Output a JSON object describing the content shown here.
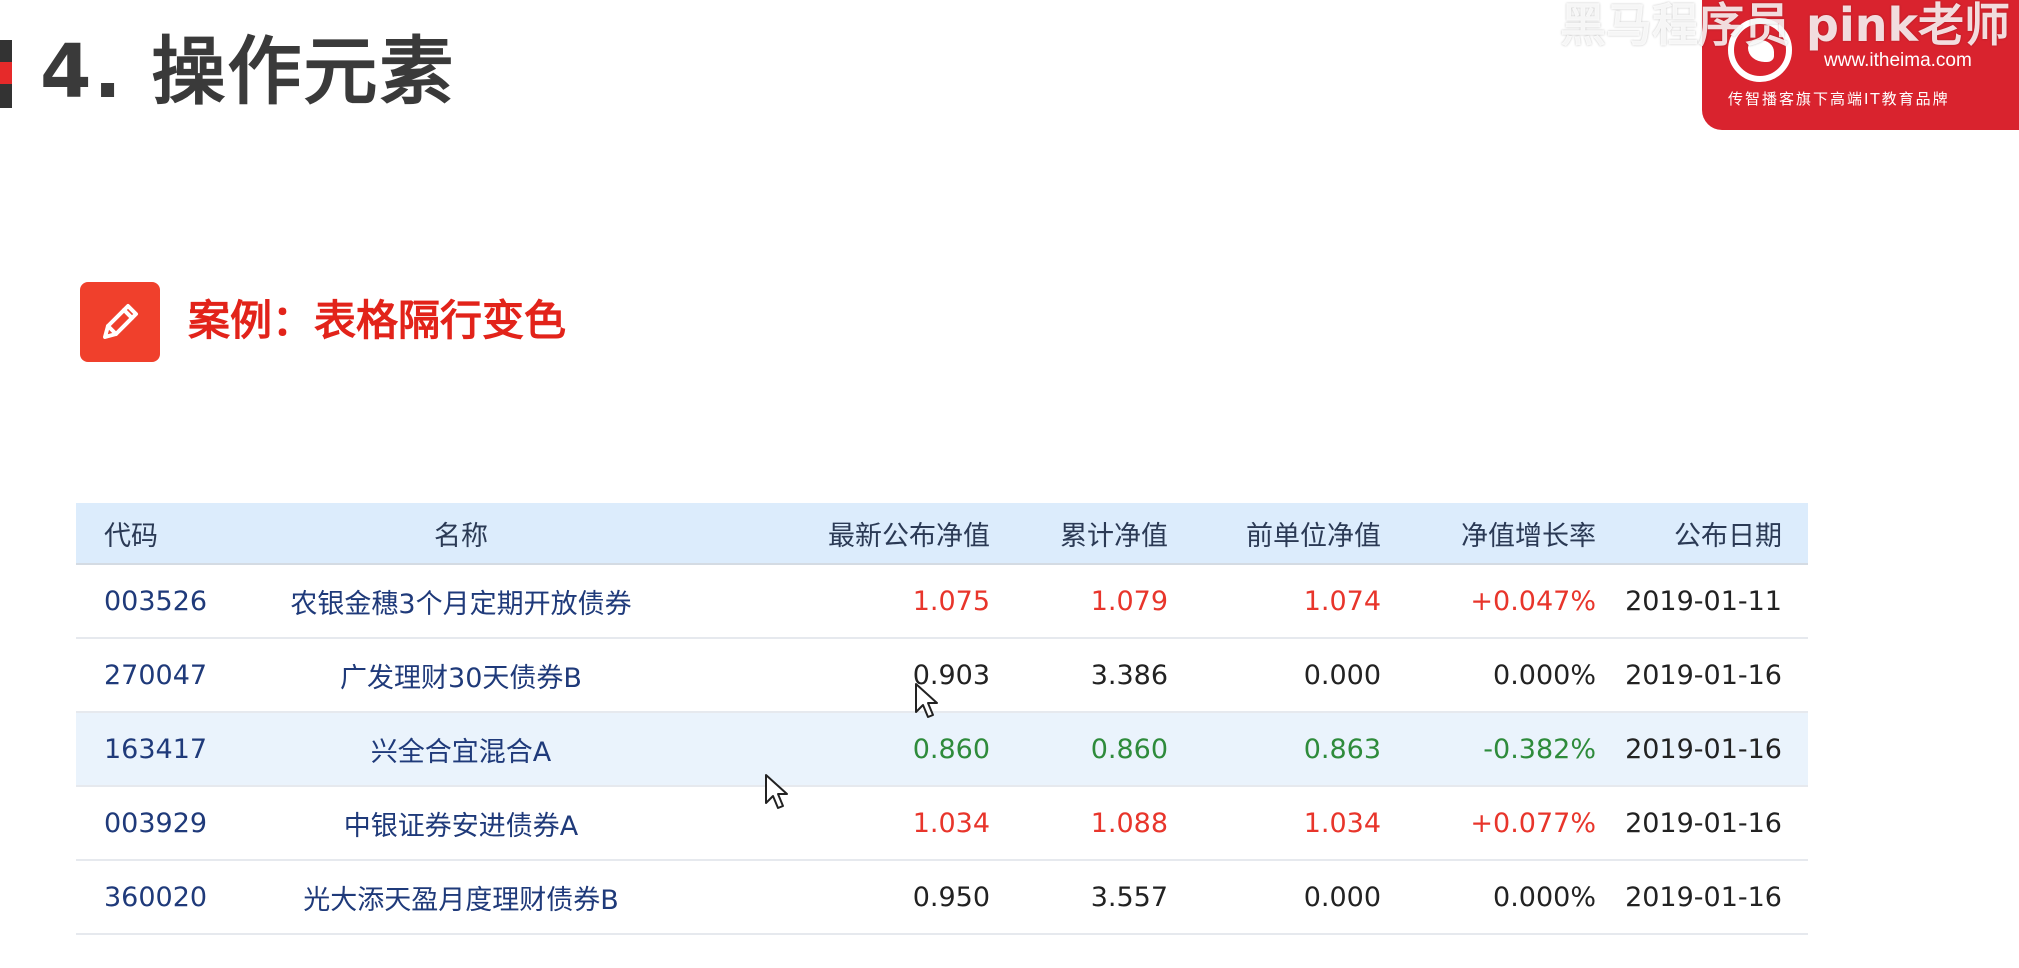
{
  "header": {
    "title": "4. 操作元素",
    "watermark": "黑马程序员 pink老师",
    "logo_url": "www.itheima.com",
    "logo_slogan": "传智播客旗下高端IT教育品牌"
  },
  "case": {
    "title": "案例：表格隔行变色"
  },
  "table": {
    "headers": [
      "代码",
      "名称",
      "最新公布净值",
      "累计净值",
      "前单位净值",
      "净值增长率",
      "公布日期"
    ],
    "rows": [
      {
        "code": "003526",
        "name": "农银金穗3个月定期开放债券",
        "latest": "1.075",
        "cumulative": "1.079",
        "previous": "1.074",
        "growth": "+0.047%",
        "date": "2019-01-11",
        "trend": "up"
      },
      {
        "code": "270047",
        "name": "广发理财30天债券B",
        "latest": "0.903",
        "cumulative": "3.386",
        "previous": "0.000",
        "growth": "0.000%",
        "date": "2019-01-16",
        "trend": "flat"
      },
      {
        "code": "163417",
        "name": "兴全合宜混合A",
        "latest": "0.860",
        "cumulative": "0.860",
        "previous": "0.863",
        "growth": "-0.382%",
        "date": "2019-01-16",
        "trend": "down"
      },
      {
        "code": "003929",
        "name": "中银证券安进债券A",
        "latest": "1.034",
        "cumulative": "1.088",
        "previous": "1.034",
        "growth": "+0.077%",
        "date": "2019-01-16",
        "trend": "up"
      },
      {
        "code": "360020",
        "name": "光大添天盈月度理财债券B",
        "latest": "0.950",
        "cumulative": "3.557",
        "previous": "0.000",
        "growth": "0.000%",
        "date": "2019-01-16",
        "trend": "flat"
      }
    ]
  },
  "colors": {
    "accent": "#e2231a",
    "header_bg": "#dcecfc",
    "stripe_bg": "#eaf3fc",
    "up": "#e8352b",
    "down": "#2e8b3b"
  }
}
